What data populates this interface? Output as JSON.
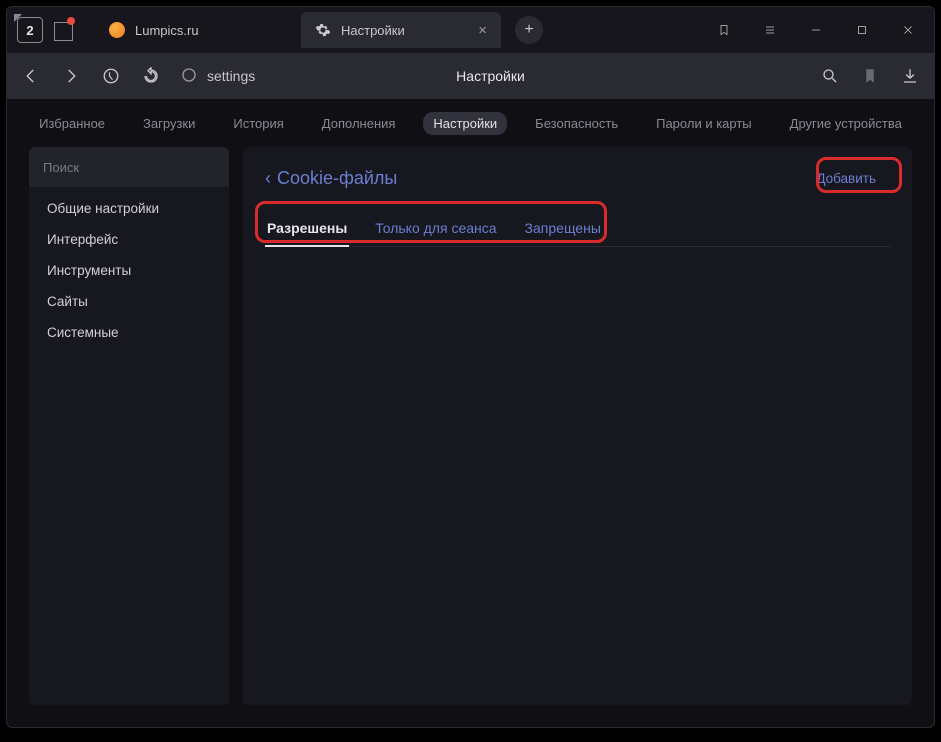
{
  "window_controls": {
    "tab_counter": "2"
  },
  "tabs": [
    {
      "title": "Lumpics.ru"
    },
    {
      "title": "Настройки"
    }
  ],
  "address": {
    "url_text": "settings",
    "page_label": "Настройки"
  },
  "topnav": {
    "items": [
      "Избранное",
      "Загрузки",
      "История",
      "Дополнения",
      "Настройки",
      "Безопасность",
      "Пароли и карты",
      "Другие устройства"
    ],
    "active_index": 4
  },
  "sidebar": {
    "search_placeholder": "Поиск",
    "items": [
      "Общие настройки",
      "Интерфейс",
      "Инструменты",
      "Сайты",
      "Системные"
    ]
  },
  "main": {
    "breadcrumb": "Cookie-файлы",
    "add_button": "Добавить",
    "subtabs": [
      "Разрешены",
      "Только для сеанса",
      "Запрещены"
    ],
    "active_subtab": 0
  }
}
